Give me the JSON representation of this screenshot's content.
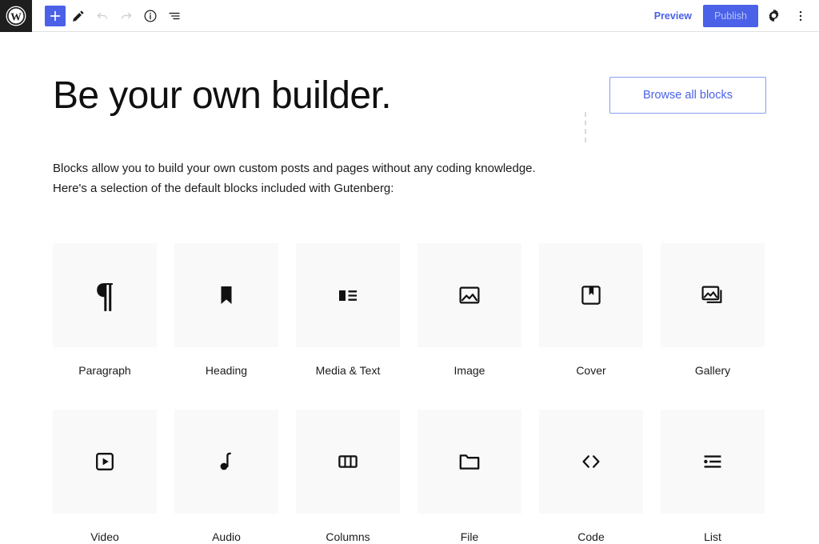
{
  "toolbar": {
    "logo_name": "wordpress-logo",
    "left_buttons": [
      {
        "name": "add-block-button",
        "icon": "plus-icon",
        "state": "active"
      },
      {
        "name": "edit-tool-button",
        "icon": "pencil-icon",
        "state": "normal"
      },
      {
        "name": "undo-button",
        "icon": "undo-arrow-icon",
        "state": "disabled"
      },
      {
        "name": "redo-button",
        "icon": "redo-arrow-icon",
        "state": "disabled"
      },
      {
        "name": "details-button",
        "icon": "info-circle-icon",
        "state": "normal"
      },
      {
        "name": "list-view-button",
        "icon": "list-view-icon",
        "state": "normal"
      }
    ],
    "preview_label": "Preview",
    "publish_label": "Publish",
    "settings_icon": "gear-icon",
    "options_icon": "kebab-menu-icon",
    "accent_color": "#4a61e8",
    "logo_background": "#1e1e1e"
  },
  "main": {
    "title": "Be your own builder.",
    "browse_button_label": "Browse all blocks",
    "paragraph_line_1": "Blocks allow you to build your own custom posts and pages without any coding knowledge.",
    "paragraph_line_2": "Here's a selection of the default blocks included with Gutenberg:"
  },
  "blocks": {
    "row1": [
      {
        "label": "Paragraph",
        "icon": "paragraph-pilcrow-icon"
      },
      {
        "label": "Heading",
        "icon": "heading-bookmark-icon"
      },
      {
        "label": "Media & Text",
        "icon": "media-and-text-icon"
      },
      {
        "label": "Image",
        "icon": "image-icon"
      },
      {
        "label": "Cover",
        "icon": "cover-icon"
      },
      {
        "label": "Gallery",
        "icon": "gallery-icon"
      }
    ],
    "row2": [
      {
        "label": "Video",
        "icon": "video-play-icon"
      },
      {
        "label": "Audio",
        "icon": "audio-note-icon"
      },
      {
        "label": "Columns",
        "icon": "columns-icon"
      },
      {
        "label": "File",
        "icon": "file-folder-icon"
      },
      {
        "label": "Code",
        "icon": "code-brackets-icon"
      },
      {
        "label": "List",
        "icon": "list-icon"
      }
    ]
  }
}
